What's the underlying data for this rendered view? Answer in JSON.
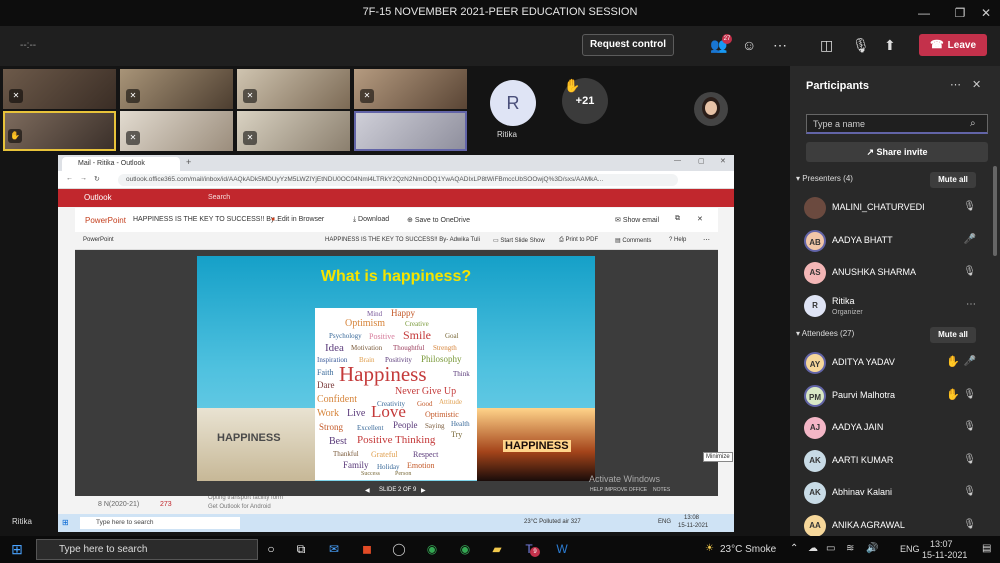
{
  "window": {
    "title": "7F-15 NOVEMBER 2021-PEER EDUCATION SESSION"
  },
  "toolbar": {
    "timer": "--:--",
    "request_control": "Request control",
    "leave": "Leave",
    "participant_badge": "27"
  },
  "tiles": {
    "r_initial": "R",
    "r_name": "Ritika",
    "overflow": "+21",
    "self_name": "Ritika"
  },
  "browser": {
    "tab": "Mail - Ritika - Outlook",
    "url": "outlook.office365.com/mail/inbox/id/AAQkADk5MDUyYzM5LWZlYjEtNDU0OC04Nml4LTRkY2QzN2NmODQ1YwAQADIxLP8tWiFBmccUbSOOwjQ%3D/sxs/AAMkA...",
    "app": "Outlook",
    "search": "Search",
    "ppt_brand": "PowerPoint",
    "ppt_doc": "HAPPINESS IS THE KEY TO SUCCESS!! By...",
    "edit_browser": "Edit in Browser",
    "download": "Download",
    "save_onedrive": "Save to OneDrive",
    "show_email": "Show email",
    "ppt_brand2": "PowerPoint",
    "doc_full": "HAPPINESS IS THE KEY TO SUCCESS!! By- Adwika Tuli",
    "start_slide": "Start Slide Show",
    "print_pdf": "Print to PDF",
    "comments": "Comments",
    "help": "Help",
    "slide_counter": "SLIDE 2 OF 9",
    "help_improve": "HELP IMPROVE OFFICE",
    "notes": "NOTES",
    "activate": "Activate Windows",
    "minimize_tip": "Minimize",
    "inner_search": "Type here to search",
    "inner_weather": "23°C  Polluted air 327",
    "inner_lang": "ENG",
    "inner_time": "13:08",
    "inner_date": "15-11-2021",
    "mail_item": "8 N(2020-21)",
    "mail_count": "273",
    "mail_snippet": "Opting transport facility form",
    "mail_snippet2": "Get Outlook for Android"
  },
  "slide": {
    "title": "What is happiness?",
    "photo_left": "HAPPINESS",
    "photo_right": "HAPPINESS",
    "cloud": [
      "Mind",
      "Happy",
      "Optimism",
      "Creative",
      "Psychology",
      "Positive",
      "Smile",
      "Goal",
      "Idea",
      "Motivation",
      "Thoughtful",
      "Strength",
      "Inspiration",
      "Brain",
      "Positivity",
      "Philosophy",
      "Faith",
      "Happiness",
      "Think",
      "Dare",
      "Never Give Up",
      "Confident",
      "Creativity",
      "Good",
      "Attitude",
      "Work",
      "Live",
      "Love",
      "Optimistic",
      "Strong",
      "Excellent",
      "People",
      "Saying",
      "Health",
      "Best",
      "Positive Thinking",
      "Try",
      "Thankful",
      "Grateful",
      "Respect",
      "Family",
      "Holiday",
      "Emotion",
      "Success",
      "Person"
    ]
  },
  "panel": {
    "title": "Participants",
    "search_placeholder": "Type a name",
    "share_invite": "Share invite",
    "presenters_label": "Presenters (4)",
    "attendees_label": "Attendees (27)",
    "mute_all": "Mute all",
    "presenters": [
      {
        "initials": "",
        "name": "MALINI_CHATURVEDI",
        "color": "#6b4a3f"
      },
      {
        "initials": "AB",
        "name": "AADYA BHATT",
        "color": "#f1c6a8"
      },
      {
        "initials": "AS",
        "name": "ANUSHKA SHARMA",
        "color": "#f3b6b6"
      },
      {
        "initials": "R",
        "name": "Ritika",
        "sub": "Organizer",
        "color": "#dfe4f5"
      }
    ],
    "attendees": [
      {
        "initials": "AY",
        "name": "ADITYA YADAV",
        "color": "#f6d79a"
      },
      {
        "initials": "PM",
        "name": "Paurvi Malhotra",
        "color": "#d9e8c6"
      },
      {
        "initials": "AJ",
        "name": "AADYA JAIN",
        "color": "#f3b6c6"
      },
      {
        "initials": "AK",
        "name": "AARTI KUMAR",
        "color": "#c8dbe6"
      },
      {
        "initials": "AK",
        "name": "Abhinav Kalani",
        "color": "#c8dbe6"
      },
      {
        "initials": "AA",
        "name": "ANIKA AGRAWAL",
        "color": "#f6d79a"
      }
    ]
  },
  "taskbar": {
    "search": "Type here to search",
    "weather": "23°C  Smoke",
    "lang": "ENG",
    "time": "13:07",
    "date": "15-11-2021",
    "teams_badge": "9"
  }
}
